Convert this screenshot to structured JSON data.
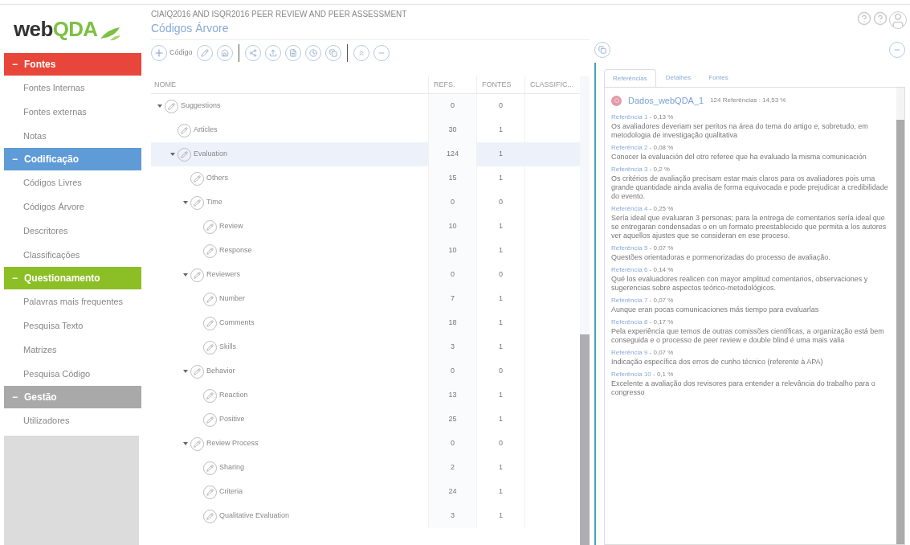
{
  "logo": {
    "part1": "web",
    "part2": "QDA"
  },
  "sidebar": {
    "sections": [
      {
        "toggle": "−",
        "title": "Fontes",
        "color": "#e8463a",
        "items": [
          {
            "label": "Fontes Internas",
            "selected": false
          },
          {
            "label": "Fontes externas",
            "selected": false
          },
          {
            "label": "Notas",
            "selected": false
          }
        ]
      },
      {
        "toggle": "−",
        "title": "Codificação",
        "color": "#5f9bd6",
        "items": [
          {
            "label": "Códigos Livres",
            "selected": false
          },
          {
            "label": "Códigos Árvore",
            "selected": false
          },
          {
            "label": "Descritores",
            "selected": false
          },
          {
            "label": "Classificações",
            "selected": false
          }
        ]
      },
      {
        "toggle": "−",
        "title": "Questionamento",
        "color": "#8cbf26",
        "items": [
          {
            "label": "Palavras mais frequentes",
            "selected": false
          },
          {
            "label": "Pesquisa Texto",
            "selected": false
          },
          {
            "label": "Matrizes",
            "selected": false
          },
          {
            "label": "Pesquisa Código",
            "selected": false
          }
        ]
      },
      {
        "toggle": "−",
        "title": "Gestão",
        "color": "#a9a9a9",
        "items": [
          {
            "label": "Utilizadores",
            "selected": false
          }
        ]
      }
    ]
  },
  "header": {
    "project": "CIAIQ2016 AND ISQR2016 PEER REVIEW AND PEER ASSESSMENT",
    "page": "Códigos Árvore"
  },
  "toolbar": {
    "add_label": "Código"
  },
  "table": {
    "columns": [
      "NOME",
      "REFS.",
      "FONTES",
      "CLASSIFIC..."
    ],
    "rows": [
      {
        "name": "Suggestions",
        "refs": "0",
        "fontes": "0",
        "expanded": true,
        "selected": false,
        "children": [
          {
            "name": "Articles",
            "refs": "30",
            "fontes": "1",
            "selected": false
          },
          {
            "name": "Evaluation",
            "refs": "124",
            "fontes": "1",
            "expanded": true,
            "selected": true,
            "children": [
              {
                "name": "Others",
                "refs": "15",
                "fontes": "1",
                "selected": false
              },
              {
                "name": "Time",
                "refs": "0",
                "fontes": "0",
                "expanded": true,
                "selected": false,
                "children": [
                  {
                    "name": "Review",
                    "refs": "10",
                    "fontes": "1",
                    "selected": false
                  },
                  {
                    "name": "Response",
                    "refs": "10",
                    "fontes": "1",
                    "selected": false
                  }
                ]
              },
              {
                "name": "Reviewers",
                "refs": "0",
                "fontes": "0",
                "expanded": true,
                "selected": false,
                "children": [
                  {
                    "name": "Number",
                    "refs": "7",
                    "fontes": "1",
                    "selected": false
                  },
                  {
                    "name": "Comments",
                    "refs": "18",
                    "fontes": "1",
                    "selected": false
                  },
                  {
                    "name": "Skills",
                    "refs": "3",
                    "fontes": "1",
                    "selected": false
                  }
                ]
              },
              {
                "name": "Behavior",
                "refs": "0",
                "fontes": "0",
                "expanded": true,
                "selected": false,
                "children": [
                  {
                    "name": "Reaction",
                    "refs": "13",
                    "fontes": "1",
                    "selected": false
                  },
                  {
                    "name": "Positive",
                    "refs": "25",
                    "fontes": "1",
                    "selected": false
                  }
                ]
              },
              {
                "name": "Review Process",
                "refs": "0",
                "fontes": "0",
                "expanded": true,
                "selected": false,
                "children": [
                  {
                    "name": "Sharing",
                    "refs": "2",
                    "fontes": "1",
                    "selected": false
                  },
                  {
                    "name": "Criteria",
                    "refs": "24",
                    "fontes": "1",
                    "selected": false
                  },
                  {
                    "name": "Qualitative Evaluation",
                    "refs": "3",
                    "fontes": "1",
                    "selected": false
                  }
                ]
              }
            ]
          }
        ]
      }
    ]
  },
  "detail": {
    "tabs": [
      {
        "label": "Referências",
        "selected": true
      },
      {
        "label": "Detalhes",
        "selected": false
      },
      {
        "label": "Fontes",
        "selected": false
      }
    ],
    "source": {
      "name": "Dados_webQDA_1",
      "summary": "124 Referências : 14,53 %"
    },
    "references": [
      {
        "label": "Referência 1",
        "share": " - 0,13 %",
        "text": "Os avaliadores deveriam ser peritos na área do tema do artigo e, sobretudo, em metodologia de investigação qualitativa"
      },
      {
        "label": "Referência 2",
        "share": " - 0,08 %",
        "text": "Conocer la evaluación del otro referee que ha evaluado la misma comunicación"
      },
      {
        "label": "Referência 3",
        "share": " - 0,2 %",
        "text": "Os critérios de avaliação precisam estar mais claros para os avaliadores pois uma grande quantidade ainda avalia de forma equivocada e pode prejudicar a credibilidade do evento."
      },
      {
        "label": "Referência 4",
        "share": " - 0,25 %",
        "text": "Sería ideal que evaluaran 3 personas; para la entrega de comentarios sería ideal que se entregaran condensadas o en un formato preestablecido que permita a los autores ver aquellos ajustes que se consideran en ese proceso."
      },
      {
        "label": "Referência 5",
        "share": " - 0,07 %",
        "text": "Questões orientadoras e pormenorizadas do processo de avaliação."
      },
      {
        "label": "Referência 6",
        "share": " - 0,14 %",
        "text": "Qué los evaluadores realicen con mayor amplitud comentarios, observaciones y sugerencias sobre aspectos teórico-metodológicos."
      },
      {
        "label": "Referência 7",
        "share": " - 0,07 %",
        "text": "Aunque eran pocas comunicaciones más tiempo para evaluarlas"
      },
      {
        "label": "Referência 8",
        "share": " - 0,17 %",
        "text": "Pela experiência que temos de outras comissões científicas, a organização está bem conseguida e o processo de peer review e double blind é uma mais valia"
      },
      {
        "label": "Referência 9",
        "share": " - 0,07 %",
        "text": "Indicação específica dos erros de cunho técnico (referente à APA)"
      },
      {
        "label": "Referência 10",
        "share": " - 0,1 %",
        "text": "Excelente a avaliação dos revisores para entender a relevância do trabalho para o congresso"
      }
    ]
  }
}
